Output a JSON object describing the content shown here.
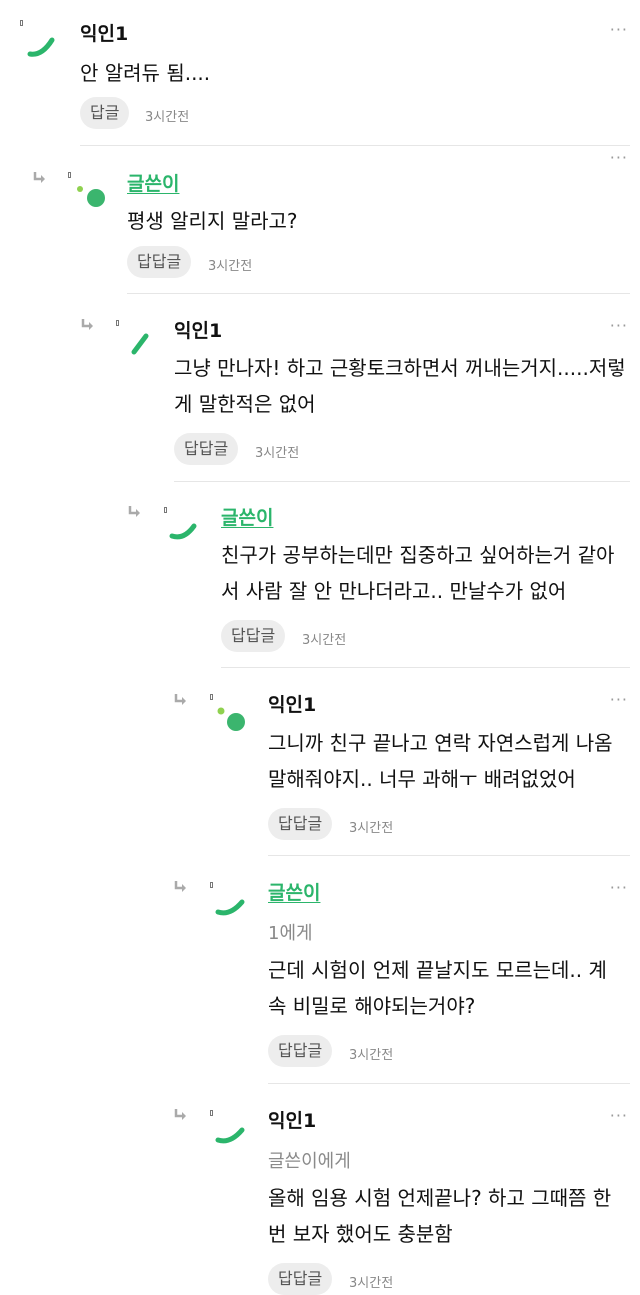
{
  "comments": [
    {
      "author": "익인1",
      "mention": "",
      "body": "안 알려듀 됨....",
      "reply_label": "답글",
      "time": "3시간전",
      "avatar": "arc"
    },
    {
      "author": "글쓴이",
      "mention": "",
      "body": "평생 알리지 말라고?",
      "reply_label": "답답글",
      "time": "3시간전",
      "avatar": "dots"
    },
    {
      "author": "익인1",
      "mention": "",
      "body": "그냥 만나자! 하고 근황토크하면서 꺼내는거지.....저렇게 말한적은 없어",
      "reply_label": "답답글",
      "time": "3시간전",
      "avatar": "slash"
    },
    {
      "author": "글쓴이",
      "mention": "",
      "body": "친구가 공부하는데만 집중하고 싶어하는거 같아서 사람 잘 안 만나더라고.. 만날수가 없어",
      "reply_label": "답답글",
      "time": "3시간전",
      "avatar": "arc"
    },
    {
      "author": "익인1",
      "mention": "",
      "body": "그니까 친구 끝나고 연락 자연스럽게 나옴 말해줘야지.. 너무 과해ㅜ 배려없었어",
      "reply_label": "답답글",
      "time": "3시간전",
      "avatar": "dots"
    },
    {
      "author": "글쓴이",
      "mention": "1에게",
      "body": "근데 시험이 언제 끝날지도 모르는데.. 계속 비밀로 해야되는거야?",
      "reply_label": "답답글",
      "time": "3시간전",
      "avatar": "arc"
    },
    {
      "author": "익인1",
      "mention": "글쓴이에게",
      "body": "올해 임용 시험 언제끝나? 하고 그때쯤 한번 보자 했어도 충분함",
      "reply_label": "답답글",
      "time": "3시간전",
      "avatar": "arc"
    }
  ],
  "ui": {
    "more_glyph": "···",
    "avatar_color": "#2bb56b",
    "avatar_light": "#8fd14f",
    "op_color": "#2bb56b"
  }
}
